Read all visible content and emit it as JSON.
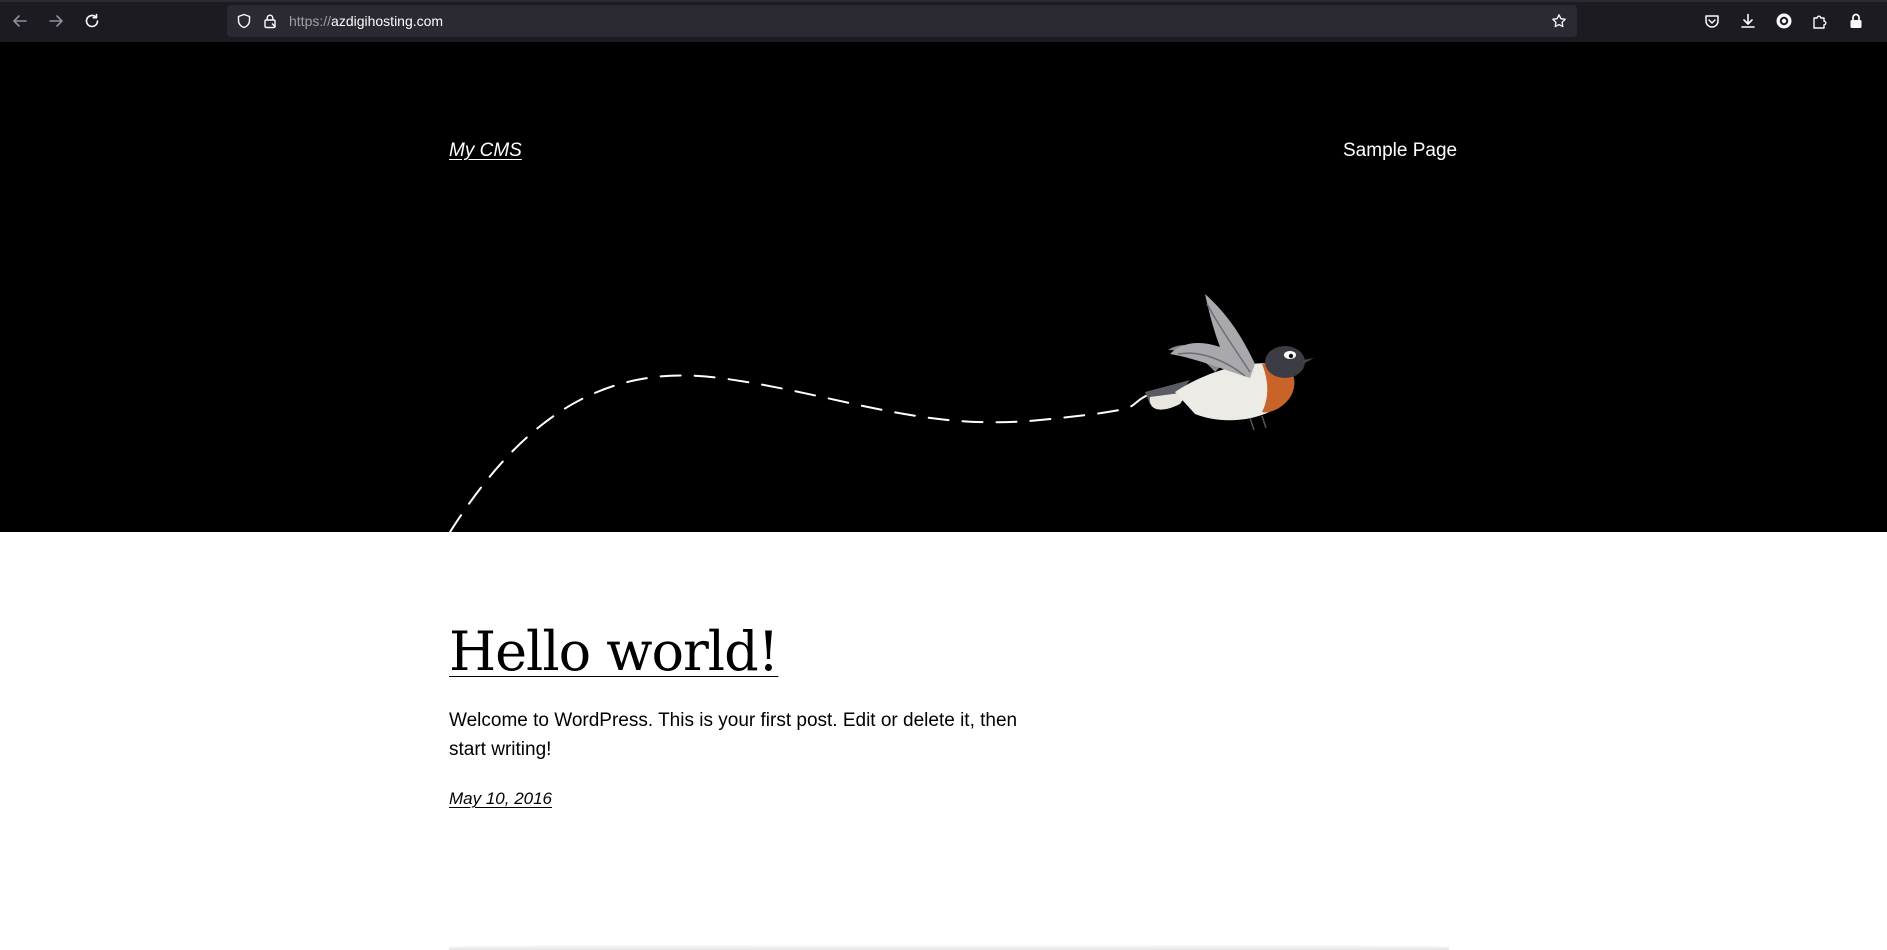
{
  "browser": {
    "url_protocol": "https://",
    "url_host": "azdigihosting.com",
    "icons": {
      "back": "back-arrow-icon",
      "forward": "forward-arrow-icon",
      "reload": "reload-icon",
      "tracking": "shield-icon",
      "lock": "lock-icon",
      "bookmark": "star-icon",
      "pocket": "pocket-icon",
      "downloads": "download-icon",
      "account": "account-icon",
      "extensions": "puzzle-icon",
      "vpn": "lock-icon"
    }
  },
  "site": {
    "title": "My CMS",
    "nav": [
      {
        "label": "Sample Page"
      }
    ]
  },
  "post": {
    "title": "Hello world!",
    "excerpt": "Welcome to WordPress. This is your first post. Edit or delete it, then start writing!",
    "date": "May 10, 2016"
  },
  "colors": {
    "hero_background": "#000000",
    "page_background": "#ffffff",
    "toolbar_background": "#1c1b22",
    "urlbar_background": "#2b2a33",
    "bird_breast": "#c8642a"
  }
}
